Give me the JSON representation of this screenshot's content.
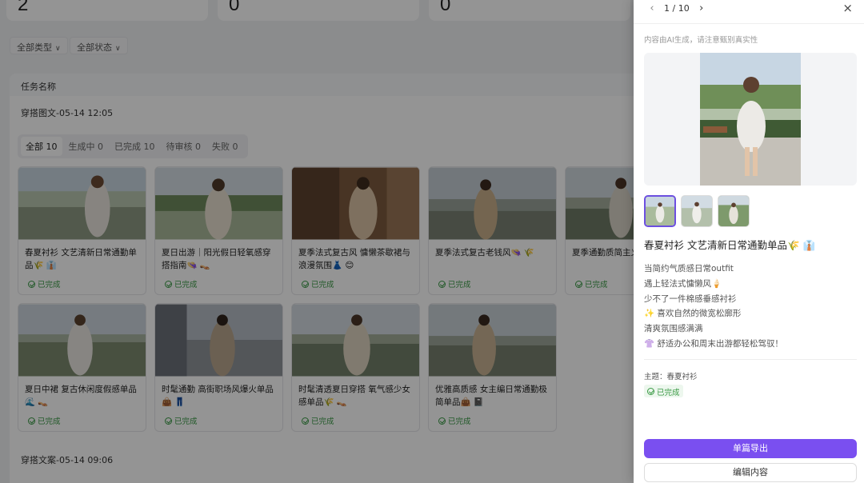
{
  "stats": [
    {
      "value": "2"
    },
    {
      "value": "0"
    },
    {
      "value": "0"
    }
  ],
  "filters": {
    "type_label": "全部类型",
    "status_label": "全部状态"
  },
  "table": {
    "column_header": "任务名称",
    "task1_name": "穿搭图文-05-14 12:05",
    "task2_name": "穿搭文案-05-14 09:06"
  },
  "tabs": [
    {
      "label": "全部",
      "count": "10"
    },
    {
      "label": "生成中",
      "count": "0"
    },
    {
      "label": "已完成",
      "count": "10"
    },
    {
      "label": "待审核",
      "count": "0"
    },
    {
      "label": "失败",
      "count": "0"
    }
  ],
  "cards": [
    {
      "title": "春夏衬衫 文艺清新日常通勤单品🌾 👔",
      "status": "已完成"
    },
    {
      "title": "夏日出游｜阳光假日轻氧感穿搭指南👒 👡",
      "status": "已完成"
    },
    {
      "title": "夏季法式复古风 慵懒茶歇裙与浪漫氛围👗 😊",
      "status": "已完成"
    },
    {
      "title": "夏季法式复古老钱风👒 🌾",
      "status": "已完成"
    },
    {
      "title": "夏季通勤质简主义穿搭🌾 🧊",
      "status": "已完成"
    },
    {
      "title": "夏日中裙 复古休闲度假感单品🌊 👡",
      "status": "已完成"
    },
    {
      "title": "时髦通勤 高街职场风爆火单品👜 👖",
      "status": "已完成"
    },
    {
      "title": "时髦清透夏日穿搭 氧气感少女感单品🌾 👡",
      "status": "已完成"
    },
    {
      "title": "优雅高质感 女主编日常通勤极简单品👜 📓",
      "status": "已完成"
    }
  ],
  "drawer": {
    "pager": "1 / 10",
    "ai_note": "内容由AI生成，请注意甄别真实性",
    "title": "春夏衬衫 文艺清新日常通勤单品🌾 👔",
    "body_lines": [
      "当简约气质感日常outfit",
      "遇上轻法式慵懒风🍦",
      "少不了一件棉感垂感衬衫",
      "✨ 喜欢自然的微宽松廓形",
      "清爽氛围感满满",
      "👚 舒适办公和周末出游都轻松驾驭！"
    ],
    "topic": "主题：春夏衬衫",
    "status": "已完成",
    "export_label": "单篇导出",
    "edit_label": "编辑内容"
  },
  "colors": {
    "accent": "#7a4ff0",
    "success": "#3a9a45",
    "overlay": "rgba(0,0,0,0.42)"
  },
  "icons": [
    "chevron-left-icon",
    "chevron-right-icon",
    "close-icon",
    "chevron-down-icon",
    "check-circle-icon"
  ]
}
